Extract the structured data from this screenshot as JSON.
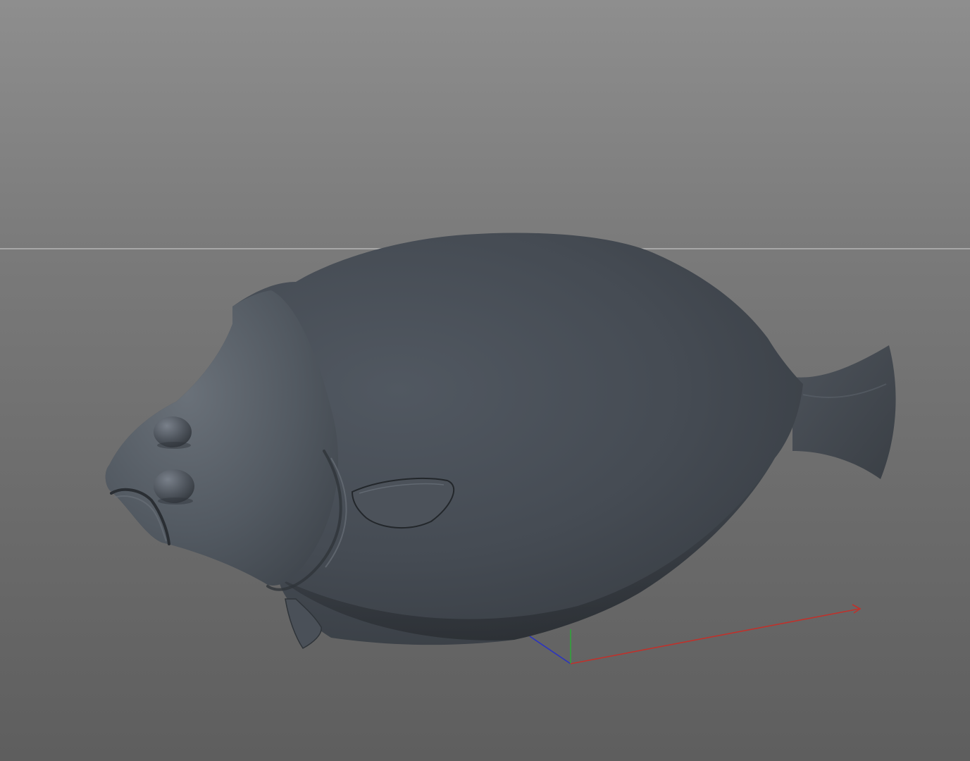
{
  "viewport": {
    "background_top": "#8e8e8e",
    "background_bottom": "#5e5e5e",
    "horizon_color": "#b4b4b4"
  },
  "model": {
    "name": "flatfish-3d-model",
    "body_color": "#4a5058",
    "shadow_color": "#373c42",
    "highlight_color": "#6b727a"
  },
  "axis_gizmo": {
    "x_axis_color": "#c0312b",
    "y_axis_color": "#2fa43a",
    "z_axis_color": "#2b34c0"
  }
}
